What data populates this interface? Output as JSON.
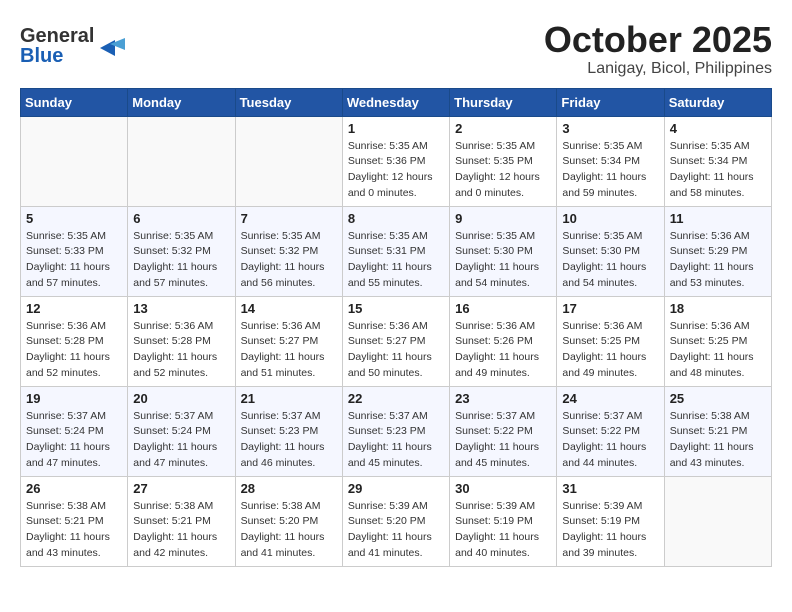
{
  "header": {
    "logo_line1": "General",
    "logo_line2": "Blue",
    "month": "October 2025",
    "location": "Lanigay, Bicol, Philippines"
  },
  "weekdays": [
    "Sunday",
    "Monday",
    "Tuesday",
    "Wednesday",
    "Thursday",
    "Friday",
    "Saturday"
  ],
  "weeks": [
    [
      {
        "day": "",
        "info": ""
      },
      {
        "day": "",
        "info": ""
      },
      {
        "day": "",
        "info": ""
      },
      {
        "day": "1",
        "info": "Sunrise: 5:35 AM\nSunset: 5:36 PM\nDaylight: 12 hours\nand 0 minutes."
      },
      {
        "day": "2",
        "info": "Sunrise: 5:35 AM\nSunset: 5:35 PM\nDaylight: 12 hours\nand 0 minutes."
      },
      {
        "day": "3",
        "info": "Sunrise: 5:35 AM\nSunset: 5:34 PM\nDaylight: 11 hours\nand 59 minutes."
      },
      {
        "day": "4",
        "info": "Sunrise: 5:35 AM\nSunset: 5:34 PM\nDaylight: 11 hours\nand 58 minutes."
      }
    ],
    [
      {
        "day": "5",
        "info": "Sunrise: 5:35 AM\nSunset: 5:33 PM\nDaylight: 11 hours\nand 57 minutes."
      },
      {
        "day": "6",
        "info": "Sunrise: 5:35 AM\nSunset: 5:32 PM\nDaylight: 11 hours\nand 57 minutes."
      },
      {
        "day": "7",
        "info": "Sunrise: 5:35 AM\nSunset: 5:32 PM\nDaylight: 11 hours\nand 56 minutes."
      },
      {
        "day": "8",
        "info": "Sunrise: 5:35 AM\nSunset: 5:31 PM\nDaylight: 11 hours\nand 55 minutes."
      },
      {
        "day": "9",
        "info": "Sunrise: 5:35 AM\nSunset: 5:30 PM\nDaylight: 11 hours\nand 54 minutes."
      },
      {
        "day": "10",
        "info": "Sunrise: 5:35 AM\nSunset: 5:30 PM\nDaylight: 11 hours\nand 54 minutes."
      },
      {
        "day": "11",
        "info": "Sunrise: 5:36 AM\nSunset: 5:29 PM\nDaylight: 11 hours\nand 53 minutes."
      }
    ],
    [
      {
        "day": "12",
        "info": "Sunrise: 5:36 AM\nSunset: 5:28 PM\nDaylight: 11 hours\nand 52 minutes."
      },
      {
        "day": "13",
        "info": "Sunrise: 5:36 AM\nSunset: 5:28 PM\nDaylight: 11 hours\nand 52 minutes."
      },
      {
        "day": "14",
        "info": "Sunrise: 5:36 AM\nSunset: 5:27 PM\nDaylight: 11 hours\nand 51 minutes."
      },
      {
        "day": "15",
        "info": "Sunrise: 5:36 AM\nSunset: 5:27 PM\nDaylight: 11 hours\nand 50 minutes."
      },
      {
        "day": "16",
        "info": "Sunrise: 5:36 AM\nSunset: 5:26 PM\nDaylight: 11 hours\nand 49 minutes."
      },
      {
        "day": "17",
        "info": "Sunrise: 5:36 AM\nSunset: 5:25 PM\nDaylight: 11 hours\nand 49 minutes."
      },
      {
        "day": "18",
        "info": "Sunrise: 5:36 AM\nSunset: 5:25 PM\nDaylight: 11 hours\nand 48 minutes."
      }
    ],
    [
      {
        "day": "19",
        "info": "Sunrise: 5:37 AM\nSunset: 5:24 PM\nDaylight: 11 hours\nand 47 minutes."
      },
      {
        "day": "20",
        "info": "Sunrise: 5:37 AM\nSunset: 5:24 PM\nDaylight: 11 hours\nand 47 minutes."
      },
      {
        "day": "21",
        "info": "Sunrise: 5:37 AM\nSunset: 5:23 PM\nDaylight: 11 hours\nand 46 minutes."
      },
      {
        "day": "22",
        "info": "Sunrise: 5:37 AM\nSunset: 5:23 PM\nDaylight: 11 hours\nand 45 minutes."
      },
      {
        "day": "23",
        "info": "Sunrise: 5:37 AM\nSunset: 5:22 PM\nDaylight: 11 hours\nand 45 minutes."
      },
      {
        "day": "24",
        "info": "Sunrise: 5:37 AM\nSunset: 5:22 PM\nDaylight: 11 hours\nand 44 minutes."
      },
      {
        "day": "25",
        "info": "Sunrise: 5:38 AM\nSunset: 5:21 PM\nDaylight: 11 hours\nand 43 minutes."
      }
    ],
    [
      {
        "day": "26",
        "info": "Sunrise: 5:38 AM\nSunset: 5:21 PM\nDaylight: 11 hours\nand 43 minutes."
      },
      {
        "day": "27",
        "info": "Sunrise: 5:38 AM\nSunset: 5:21 PM\nDaylight: 11 hours\nand 42 minutes."
      },
      {
        "day": "28",
        "info": "Sunrise: 5:38 AM\nSunset: 5:20 PM\nDaylight: 11 hours\nand 41 minutes."
      },
      {
        "day": "29",
        "info": "Sunrise: 5:39 AM\nSunset: 5:20 PM\nDaylight: 11 hours\nand 41 minutes."
      },
      {
        "day": "30",
        "info": "Sunrise: 5:39 AM\nSunset: 5:19 PM\nDaylight: 11 hours\nand 40 minutes."
      },
      {
        "day": "31",
        "info": "Sunrise: 5:39 AM\nSunset: 5:19 PM\nDaylight: 11 hours\nand 39 minutes."
      },
      {
        "day": "",
        "info": ""
      }
    ]
  ]
}
